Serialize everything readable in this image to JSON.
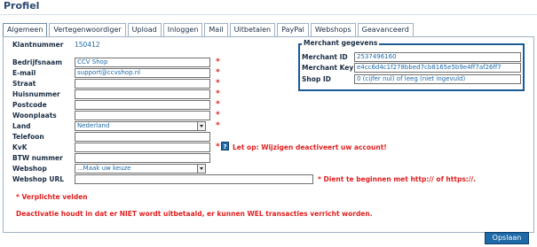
{
  "page": {
    "title": "Profiel"
  },
  "tabs": [
    {
      "label": "Algemeen"
    },
    {
      "label": "Vertegenwoordiger"
    },
    {
      "label": "Upload"
    },
    {
      "label": "Inloggen"
    },
    {
      "label": "Mail"
    },
    {
      "label": "Uitbetalen"
    },
    {
      "label": "PayPal"
    },
    {
      "label": "Webshops"
    },
    {
      "label": "Geavanceerd"
    }
  ],
  "form": {
    "klantnummer": {
      "label": "Klantnummer",
      "value": "150412"
    },
    "bedrijfsnaam": {
      "label": "Bedrijfsnaam",
      "value": "CCV Shop"
    },
    "email": {
      "label": "E-mail",
      "value": "support@ccvshop.nl"
    },
    "straat": {
      "label": "Straat",
      "value": ""
    },
    "huisnummer": {
      "label": "Huisnummer",
      "value": ""
    },
    "postcode": {
      "label": "Postcode",
      "value": ""
    },
    "woonplaats": {
      "label": "Woonplaats",
      "value": ""
    },
    "land": {
      "label": "Land",
      "value": "Nederland"
    },
    "telefoon": {
      "label": "Telefoon",
      "value": ""
    },
    "kvk": {
      "label": "KvK",
      "value": "",
      "warning": "Let op: Wijzigen deactiveert uw account!"
    },
    "btw": {
      "label": "BTW nummer",
      "value": ""
    },
    "webshop": {
      "label": "Webshop",
      "value": "...Maak uw keuze"
    },
    "webshop_url": {
      "label": "Webshop URL",
      "value": "",
      "hint": "* Dient te beginnen met http:// of https://."
    },
    "required_marker": "*",
    "help_glyph": "?"
  },
  "merchant": {
    "legend": "Merchant gegevens",
    "merchant_id": {
      "label": "Merchant ID",
      "value": "2537496160"
    },
    "merchant_key": {
      "label": "Merchant Key",
      "value": "e4cc6d4c1f278bbed7cb8165e5b9e4ff7af26ff7"
    },
    "shop_id": {
      "label": "Shop ID",
      "value": "0 (cijfer nul) of leeg (niet ingevuld)"
    }
  },
  "notes": {
    "required": "* Verplichte velden",
    "deactivation": "Deactivatie houdt in dat er NIET wordt uitbetaald, er kunnen WEL transacties verricht worden."
  },
  "actions": {
    "save_label": "Opslaan"
  },
  "colors": {
    "accent": "#1e6aa8",
    "warning": "#e02020",
    "border": "#1c5a93"
  }
}
